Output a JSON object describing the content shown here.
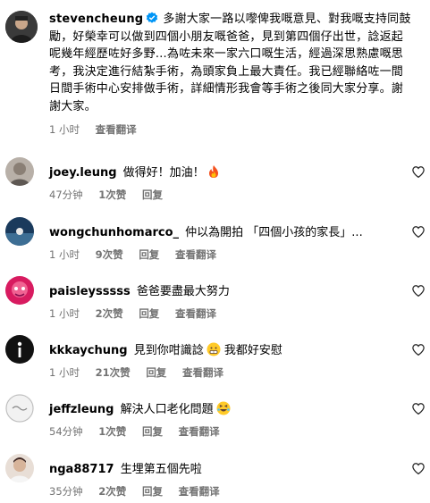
{
  "post": {
    "username": "stevencheung",
    "caption": "多謝大家一路以嚟俾我嘅意見、對我嘅支持同鼓勵，好榮幸可以做到四個小朋友嘅爸爸，見到第四個仔出世，諗返起呢幾年經歷咗好多野…為咗未來一家六口嘅生活，經過深思熟慮嘅思考，我決定進行結紮手術，為頭家負上最大責任。我已經聯絡咗一間日間手術中心安排做手術，詳細情形我會等手術之後同大家分享。謝謝大家。",
    "time": "1 小时",
    "translate": "查看翻译"
  },
  "comments": [
    {
      "username": "joey.leung",
      "text": "做得好！加油！",
      "emoji": "fire-emoji",
      "time": "47分钟",
      "likes": "1次赞",
      "reply": "回复",
      "translate": ""
    },
    {
      "username": "wongchunhomarco_",
      "text": "仲以為開拍 「四個小孩的家長」...",
      "emoji": "",
      "time": "1 小时",
      "likes": "9次赞",
      "reply": "回复",
      "translate": "查看翻译"
    },
    {
      "username": "paisleysssss",
      "text": "爸爸要盡最大努力",
      "emoji": "",
      "time": "1 小时",
      "likes": "2次赞",
      "reply": "回复",
      "translate": "查看翻译"
    },
    {
      "username": "kkkaychung",
      "text": "見到你咁識諗",
      "emoji2": "grimace-emoji",
      "text2": "我都好安慰",
      "time": "1 小时",
      "likes": "21次赞",
      "reply": "回复",
      "translate": "查看翻译"
    },
    {
      "username": "jeffzleung",
      "text": "解決人口老化問題",
      "emoji": "laughing-emoji",
      "time": "54分钟",
      "likes": "1次赞",
      "reply": "回复",
      "translate": "查看翻译"
    },
    {
      "username": "nga88717",
      "text": "生埋第五個先啦",
      "emoji": "",
      "time": "35分钟",
      "likes": "2次赞",
      "reply": "回复",
      "translate": "查看翻译"
    }
  ]
}
